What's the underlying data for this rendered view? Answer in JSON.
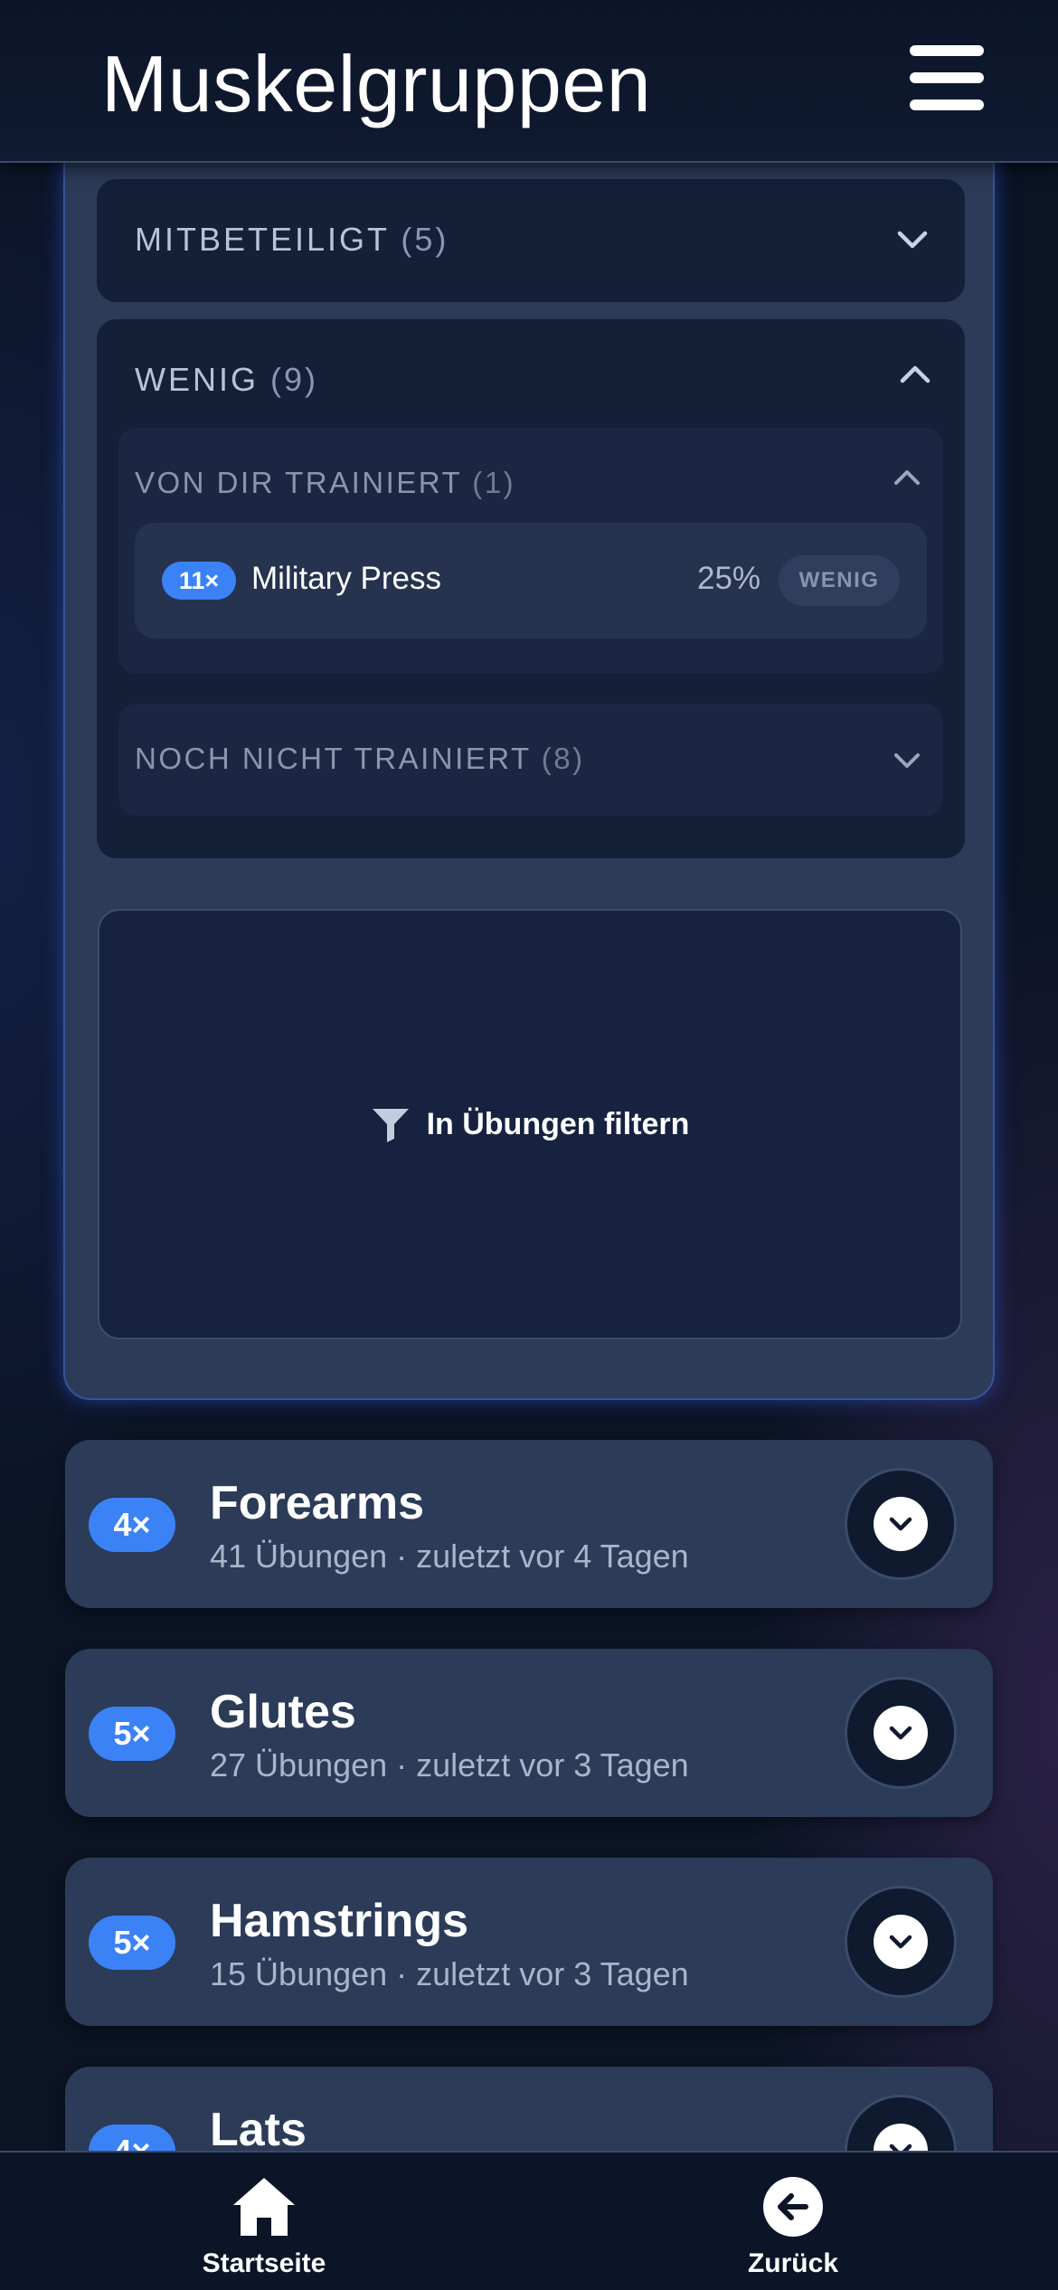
{
  "header": {
    "title": "Muskelgruppen",
    "menu_icon": "hamburger-menu-icon"
  },
  "expanded": {
    "mitbeteiligt": {
      "label": "MITBETEILIGT",
      "count": "(5)"
    },
    "wenig": {
      "label": "WENIG",
      "count": "(9)",
      "trained": {
        "label": "VON DIR TRAINIERT",
        "count": "(1)",
        "exercises": [
          {
            "badge": "11×",
            "name": "Military Press",
            "percent": "25%",
            "level": "WENIG"
          }
        ]
      },
      "untrained": {
        "label": "NOCH NICHT TRAINIERT",
        "count": "(8)"
      }
    },
    "filter_label": "In Übungen filtern"
  },
  "muscles": [
    {
      "badge": "4×",
      "name": "Forearms",
      "sub": "41 Übungen · zuletzt vor 4 Tagen"
    },
    {
      "badge": "5×",
      "name": "Glutes",
      "sub": "27 Übungen · zuletzt vor 3 Tagen"
    },
    {
      "badge": "5×",
      "name": "Hamstrings",
      "sub": "15 Übungen · zuletzt vor 3 Tagen"
    },
    {
      "badge": "4×",
      "name": "Lats",
      "sub": ""
    }
  ],
  "nav": {
    "home": {
      "label": "Startseite",
      "icon": "home-icon"
    },
    "back": {
      "label": "Zurück",
      "icon": "arrow-left-circle-icon"
    }
  },
  "colors": {
    "accent": "#3b82f6",
    "card": "#2b3b58",
    "background": "#0b1324"
  }
}
